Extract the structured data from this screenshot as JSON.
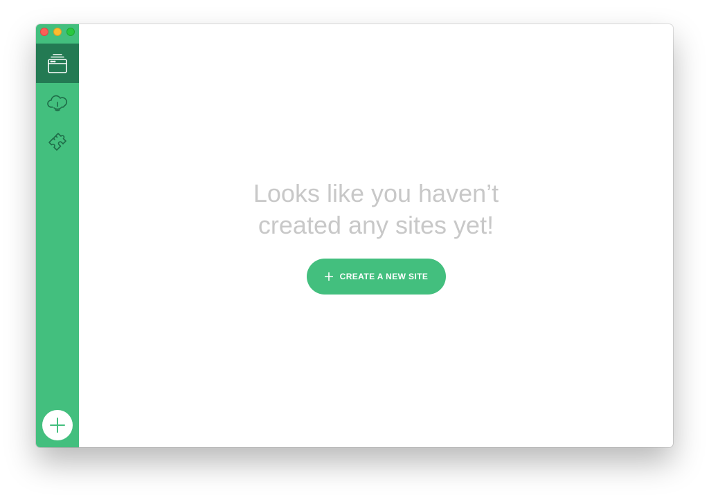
{
  "window": {
    "controls": [
      "close",
      "minimize",
      "zoom"
    ]
  },
  "sidebar": {
    "items": [
      {
        "name": "sites",
        "icon": "sites-stack-icon",
        "active": true
      },
      {
        "name": "cloud",
        "icon": "cloud-sync-icon",
        "active": false
      },
      {
        "name": "addons",
        "icon": "puzzle-piece-icon",
        "active": false
      }
    ],
    "add_button_icon": "plus-icon"
  },
  "main": {
    "empty_line1": "Looks like you haven’t",
    "empty_line2": "created any sites yet!",
    "create_label": "CREATE A NEW SITE",
    "create_icon": "plus-icon"
  },
  "colors": {
    "accent": "#43bf7e",
    "sidebar_active": "#237a53",
    "muted_text": "#c8c8c8"
  }
}
